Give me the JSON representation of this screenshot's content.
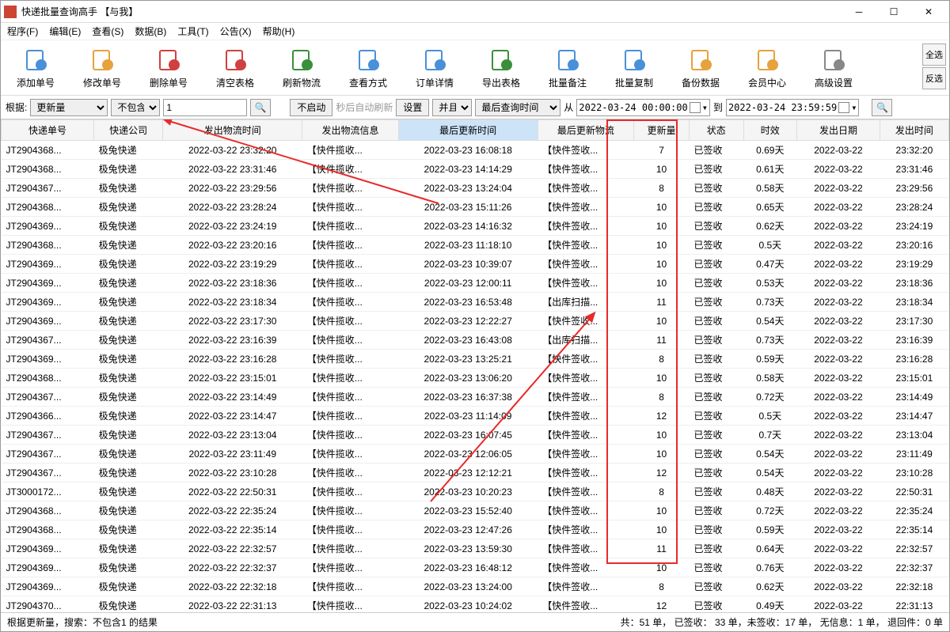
{
  "window": {
    "title": "快递批量查询高手 【与我】"
  },
  "menu": {
    "items": [
      "程序(F)",
      "编辑(E)",
      "查看(S)",
      "数据(B)",
      "工具(T)",
      "公告(X)",
      "帮助(H)"
    ]
  },
  "toolbar": {
    "buttons": [
      {
        "label": "添加单号",
        "icon": "doc-plus"
      },
      {
        "label": "修改单号",
        "icon": "doc-edit"
      },
      {
        "label": "删除单号",
        "icon": "doc-del"
      },
      {
        "label": "清空表格",
        "icon": "clear"
      },
      {
        "label": "刷新物流",
        "icon": "refresh"
      },
      {
        "label": "查看方式",
        "icon": "view"
      },
      {
        "label": "订单详情",
        "icon": "list"
      },
      {
        "label": "导出表格",
        "icon": "export"
      },
      {
        "label": "批量备注",
        "icon": "note"
      },
      {
        "label": "批量复制",
        "icon": "copy"
      },
      {
        "label": "备份数据",
        "icon": "backup"
      },
      {
        "label": "会员中心",
        "icon": "member"
      },
      {
        "label": "高级设置",
        "icon": "settings"
      }
    ],
    "side": {
      "all": "全选",
      "inv": "反选"
    }
  },
  "filter": {
    "label": "根据:",
    "field": "更新量",
    "op": "不包含",
    "value": "1",
    "noStart": "不启动",
    "autoRefresh": "秒后自动刷新",
    "settings": "设置",
    "and": "并且",
    "lastQuery": "最后查询时间",
    "from": "从",
    "date1": "2022-03-24 00:00:00",
    "to": "到",
    "date2": "2022-03-24 23:59:59"
  },
  "columns": [
    "快递单号",
    "快递公司",
    "发出物流时间",
    "发出物流信息",
    "最后更新时间",
    "最后更新物流",
    "更新量",
    "状态",
    "时效",
    "发出日期",
    "发出时间"
  ],
  "rows": [
    {
      "c0": "JT2904368...",
      "c1": "极兔快递",
      "c2": "2022-03-22 23:32:20",
      "c3": "【快件揽收...",
      "c4": "2022-03-23 16:08:18",
      "c5": "【快件签收...",
      "c6": "7",
      "c7": "已签收",
      "c8": "0.69天",
      "c9": "2022-03-22",
      "c10": "23:32:20"
    },
    {
      "c0": "JT2904368...",
      "c1": "极兔快递",
      "c2": "2022-03-22 23:31:46",
      "c3": "【快件揽收...",
      "c4": "2022-03-23 14:14:29",
      "c5": "【快件签收...",
      "c6": "10",
      "c7": "已签收",
      "c8": "0.61天",
      "c9": "2022-03-22",
      "c10": "23:31:46"
    },
    {
      "c0": "JT2904367...",
      "c1": "极兔快递",
      "c2": "2022-03-22 23:29:56",
      "c3": "【快件揽收...",
      "c4": "2022-03-23 13:24:04",
      "c5": "【快件签收...",
      "c6": "8",
      "c7": "已签收",
      "c8": "0.58天",
      "c9": "2022-03-22",
      "c10": "23:29:56"
    },
    {
      "c0": "JT2904368...",
      "c1": "极兔快递",
      "c2": "2022-03-22 23:28:24",
      "c3": "【快件揽收...",
      "c4": "2022-03-23 15:11:26",
      "c5": "【快件签收...",
      "c6": "10",
      "c7": "已签收",
      "c8": "0.65天",
      "c9": "2022-03-22",
      "c10": "23:28:24"
    },
    {
      "c0": "JT2904369...",
      "c1": "极兔快递",
      "c2": "2022-03-22 23:24:19",
      "c3": "【快件揽收...",
      "c4": "2022-03-23 14:16:32",
      "c5": "【快件签收...",
      "c6": "10",
      "c7": "已签收",
      "c8": "0.62天",
      "c9": "2022-03-22",
      "c10": "23:24:19"
    },
    {
      "c0": "JT2904368...",
      "c1": "极兔快递",
      "c2": "2022-03-22 23:20:16",
      "c3": "【快件揽收...",
      "c4": "2022-03-23 11:18:10",
      "c5": "【快件签收...",
      "c6": "10",
      "c7": "已签收",
      "c8": "0.5天",
      "c9": "2022-03-22",
      "c10": "23:20:16"
    },
    {
      "c0": "JT2904369...",
      "c1": "极兔快递",
      "c2": "2022-03-22 23:19:29",
      "c3": "【快件揽收...",
      "c4": "2022-03-23 10:39:07",
      "c5": "【快件签收...",
      "c6": "10",
      "c7": "已签收",
      "c8": "0.47天",
      "c9": "2022-03-22",
      "c10": "23:19:29"
    },
    {
      "c0": "JT2904369...",
      "c1": "极兔快递",
      "c2": "2022-03-22 23:18:36",
      "c3": "【快件揽收...",
      "c4": "2022-03-23 12:00:11",
      "c5": "【快件签收...",
      "c6": "10",
      "c7": "已签收",
      "c8": "0.53天",
      "c9": "2022-03-22",
      "c10": "23:18:36"
    },
    {
      "c0": "JT2904369...",
      "c1": "极兔快递",
      "c2": "2022-03-22 23:18:34",
      "c3": "【快件揽收...",
      "c4": "2022-03-23 16:53:48",
      "c5": "【出库扫描...",
      "c6": "11",
      "c7": "已签收",
      "c8": "0.73天",
      "c9": "2022-03-22",
      "c10": "23:18:34"
    },
    {
      "c0": "JT2904369...",
      "c1": "极兔快递",
      "c2": "2022-03-22 23:17:30",
      "c3": "【快件揽收...",
      "c4": "2022-03-23 12:22:27",
      "c5": "【快件签收...",
      "c6": "10",
      "c7": "已签收",
      "c8": "0.54天",
      "c9": "2022-03-22",
      "c10": "23:17:30"
    },
    {
      "c0": "JT2904367...",
      "c1": "极兔快递",
      "c2": "2022-03-22 23:16:39",
      "c3": "【快件揽收...",
      "c4": "2022-03-23 16:43:08",
      "c5": "【出库扫描...",
      "c6": "11",
      "c7": "已签收",
      "c8": "0.73天",
      "c9": "2022-03-22",
      "c10": "23:16:39"
    },
    {
      "c0": "JT2904369...",
      "c1": "极兔快递",
      "c2": "2022-03-22 23:16:28",
      "c3": "【快件揽收...",
      "c4": "2022-03-23 13:25:21",
      "c5": "【快件签收...",
      "c6": "8",
      "c7": "已签收",
      "c8": "0.59天",
      "c9": "2022-03-22",
      "c10": "23:16:28"
    },
    {
      "c0": "JT2904368...",
      "c1": "极兔快递",
      "c2": "2022-03-22 23:15:01",
      "c3": "【快件揽收...",
      "c4": "2022-03-23 13:06:20",
      "c5": "【快件签收...",
      "c6": "10",
      "c7": "已签收",
      "c8": "0.58天",
      "c9": "2022-03-22",
      "c10": "23:15:01"
    },
    {
      "c0": "JT2904367...",
      "c1": "极兔快递",
      "c2": "2022-03-22 23:14:49",
      "c3": "【快件揽收...",
      "c4": "2022-03-23 16:37:38",
      "c5": "【快件签收...",
      "c6": "8",
      "c7": "已签收",
      "c8": "0.72天",
      "c9": "2022-03-22",
      "c10": "23:14:49"
    },
    {
      "c0": "JT2904366...",
      "c1": "极兔快递",
      "c2": "2022-03-22 23:14:47",
      "c3": "【快件揽收...",
      "c4": "2022-03-23 11:14:09",
      "c5": "【快件签收...",
      "c6": "12",
      "c7": "已签收",
      "c8": "0.5天",
      "c9": "2022-03-22",
      "c10": "23:14:47"
    },
    {
      "c0": "JT2904367...",
      "c1": "极兔快递",
      "c2": "2022-03-22 23:13:04",
      "c3": "【快件揽收...",
      "c4": "2022-03-23 16:07:45",
      "c5": "【快件签收...",
      "c6": "10",
      "c7": "已签收",
      "c8": "0.7天",
      "c9": "2022-03-22",
      "c10": "23:13:04"
    },
    {
      "c0": "JT2904367...",
      "c1": "极兔快递",
      "c2": "2022-03-22 23:11:49",
      "c3": "【快件揽收...",
      "c4": "2022-03-23 12:06:05",
      "c5": "【快件签收...",
      "c6": "10",
      "c7": "已签收",
      "c8": "0.54天",
      "c9": "2022-03-22",
      "c10": "23:11:49"
    },
    {
      "c0": "JT2904367...",
      "c1": "极兔快递",
      "c2": "2022-03-22 23:10:28",
      "c3": "【快件揽收...",
      "c4": "2022-03-23 12:12:21",
      "c5": "【快件签收...",
      "c6": "12",
      "c7": "已签收",
      "c8": "0.54天",
      "c9": "2022-03-22",
      "c10": "23:10:28"
    },
    {
      "c0": "JT3000172...",
      "c1": "极兔快递",
      "c2": "2022-03-22 22:50:31",
      "c3": "【快件揽收...",
      "c4": "2022-03-23 10:20:23",
      "c5": "【快件签收...",
      "c6": "8",
      "c7": "已签收",
      "c8": "0.48天",
      "c9": "2022-03-22",
      "c10": "22:50:31"
    },
    {
      "c0": "JT2904368...",
      "c1": "极兔快递",
      "c2": "2022-03-22 22:35:24",
      "c3": "【快件揽收...",
      "c4": "2022-03-23 15:52:40",
      "c5": "【快件签收...",
      "c6": "10",
      "c7": "已签收",
      "c8": "0.72天",
      "c9": "2022-03-22",
      "c10": "22:35:24"
    },
    {
      "c0": "JT2904368...",
      "c1": "极兔快递",
      "c2": "2022-03-22 22:35:14",
      "c3": "【快件揽收...",
      "c4": "2022-03-23 12:47:26",
      "c5": "【快件签收...",
      "c6": "10",
      "c7": "已签收",
      "c8": "0.59天",
      "c9": "2022-03-22",
      "c10": "22:35:14"
    },
    {
      "c0": "JT2904369...",
      "c1": "极兔快递",
      "c2": "2022-03-22 22:32:57",
      "c3": "【快件揽收...",
      "c4": "2022-03-23 13:59:30",
      "c5": "【快件签收...",
      "c6": "11",
      "c7": "已签收",
      "c8": "0.64天",
      "c9": "2022-03-22",
      "c10": "22:32:57"
    },
    {
      "c0": "JT2904369...",
      "c1": "极兔快递",
      "c2": "2022-03-22 22:32:37",
      "c3": "【快件揽收...",
      "c4": "2022-03-23 16:48:12",
      "c5": "【快件签收...",
      "c6": "10",
      "c7": "已签收",
      "c8": "0.76天",
      "c9": "2022-03-22",
      "c10": "22:32:37"
    },
    {
      "c0": "JT2904369...",
      "c1": "极兔快递",
      "c2": "2022-03-22 22:32:18",
      "c3": "【快件揽收...",
      "c4": "2022-03-23 13:24:00",
      "c5": "【快件签收...",
      "c6": "8",
      "c7": "已签收",
      "c8": "0.62天",
      "c9": "2022-03-22",
      "c10": "22:32:18"
    },
    {
      "c0": "JT2904370...",
      "c1": "极兔快递",
      "c2": "2022-03-22 22:31:13",
      "c3": "【快件揽收...",
      "c4": "2022-03-23 10:24:02",
      "c5": "【快件签收...",
      "c6": "12",
      "c7": "已签收",
      "c8": "0.49天",
      "c9": "2022-03-22",
      "c10": "22:31:13"
    }
  ],
  "status": {
    "left": "根据更新量，搜索：不包含1 的结果",
    "right": "共：51 单，  已签收：  33 单，未签收：17 单，  无信息：1 单，  退回件：0 单"
  }
}
